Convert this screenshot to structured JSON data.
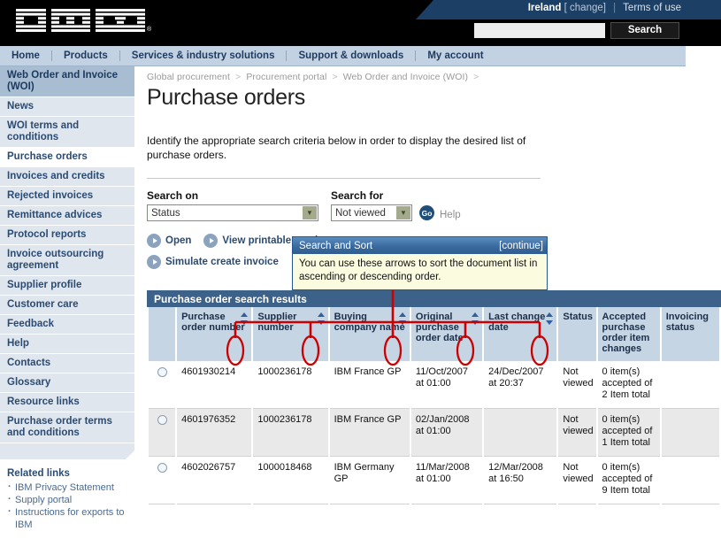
{
  "header": {
    "country": "Ireland",
    "change_link": "[ change]",
    "terms_link": "Terms of use",
    "logo_alt": "IBM",
    "search_placeholder": "",
    "search_value": "",
    "search_button": "Search"
  },
  "nav": {
    "items": [
      {
        "label": "Home"
      },
      {
        "label": "Products"
      },
      {
        "label": "Services & industry solutions"
      },
      {
        "label": "Support & downloads"
      },
      {
        "label": "My account"
      }
    ]
  },
  "sidebar": {
    "items": [
      {
        "label": "Web Order and Invoice (WOI)",
        "state": "current"
      },
      {
        "label": "News",
        "state": "normal"
      },
      {
        "label": "WOI terms and conditions",
        "state": "normal"
      },
      {
        "label": "Purchase orders",
        "state": "active"
      },
      {
        "label": "Invoices and credits",
        "state": "normal"
      },
      {
        "label": "Rejected invoices",
        "state": "normal"
      },
      {
        "label": "Remittance advices",
        "state": "normal"
      },
      {
        "label": "Protocol reports",
        "state": "normal"
      },
      {
        "label": "Invoice outsourcing agreement",
        "state": "normal"
      },
      {
        "label": "Supplier profile",
        "state": "normal"
      },
      {
        "label": "Customer care",
        "state": "normal"
      },
      {
        "label": "Feedback",
        "state": "normal"
      },
      {
        "label": "Help",
        "state": "normal"
      },
      {
        "label": "Contacts",
        "state": "normal"
      },
      {
        "label": "Glossary",
        "state": "normal"
      },
      {
        "label": "Resource links",
        "state": "normal"
      },
      {
        "label": "Purchase order terms and conditions",
        "state": "normal"
      }
    ],
    "related": {
      "title": "Related links",
      "links": [
        {
          "label": "IBM Privacy Statement"
        },
        {
          "label": "Supply portal"
        },
        {
          "label": "Instructions for exports to IBM"
        }
      ]
    }
  },
  "breadcrumb": {
    "items": [
      {
        "label": "Global procurement"
      },
      {
        "label": "Procurement portal"
      },
      {
        "label": "Web Order and Invoice (WOI)"
      }
    ],
    "separator": ">",
    "trailing": ">"
  },
  "main": {
    "page_title": "Purchase orders",
    "intro": "Identify the appropriate search criteria below in order to display the desired list of purchase orders.",
    "help_link": "Help",
    "help_right": "Help"
  },
  "search": {
    "search_on_label": "Search on",
    "search_on_value": "Status",
    "search_for_label": "Search for",
    "search_for_value": "Not viewed",
    "go_label": "Go"
  },
  "actions": [
    {
      "label": "Open"
    },
    {
      "label": "View printable version"
    },
    {
      "label": "Simulate create invoice"
    }
  ],
  "tooltip": {
    "title": "Search and Sort",
    "continue_label": "[continue]",
    "body": "You can use these arrows to sort the document list in ascending or descending order."
  },
  "table": {
    "title": "Purchase order search results",
    "columns": [
      {
        "label": "",
        "sortable": false
      },
      {
        "label": "Purchase order number",
        "sortable": true
      },
      {
        "label": "Supplier number",
        "sortable": true
      },
      {
        "label": "Buying company name",
        "sortable": true
      },
      {
        "label": "Original purchase order date",
        "sortable": true
      },
      {
        "label": "Last change date",
        "sortable": true
      },
      {
        "label": "Status",
        "sortable": false
      },
      {
        "label": "Accepted purchase order item changes",
        "sortable": false
      },
      {
        "label": "Invoicing status",
        "sortable": false
      }
    ],
    "rows": [
      {
        "po_number": "4601930214",
        "supplier_number": "1000236178",
        "buying_company": "IBM France GP",
        "original_date": "11/Oct/2007 at 01:00",
        "last_change": "24/Dec/2007 at 20:37",
        "status": "Not viewed",
        "accepted_changes": "0 item(s) accepted of 2 Item total",
        "invoicing_status": ""
      },
      {
        "po_number": "4601976352",
        "supplier_number": "1000236178",
        "buying_company": "IBM France GP",
        "original_date": "02/Jan/2008 at 01:00",
        "last_change": "",
        "status": "Not viewed",
        "accepted_changes": "0 item(s) accepted of 1 Item total",
        "invoicing_status": ""
      },
      {
        "po_number": "4602026757",
        "supplier_number": "1000018468",
        "buying_company": "IBM Germany GP",
        "original_date": "11/Mar/2008 at 01:00",
        "last_change": "12/Mar/2008 at 16:50",
        "status": "Not viewed",
        "accepted_changes": "0 item(s) accepted of 9 Item total",
        "invoicing_status": ""
      }
    ]
  },
  "colors": {
    "masthead": "#000000",
    "util_bar": "#1c3f66",
    "nav_bar": "#c2d2e2",
    "sidebar": "#dfe6ee",
    "sidebar_current": "#a8bdd2",
    "table_title": "#3c6289",
    "table_header": "#c6d5e4",
    "annotation": "#cc0000",
    "tooltip_body": "#fbfbe0",
    "link": "#2b4b72"
  }
}
